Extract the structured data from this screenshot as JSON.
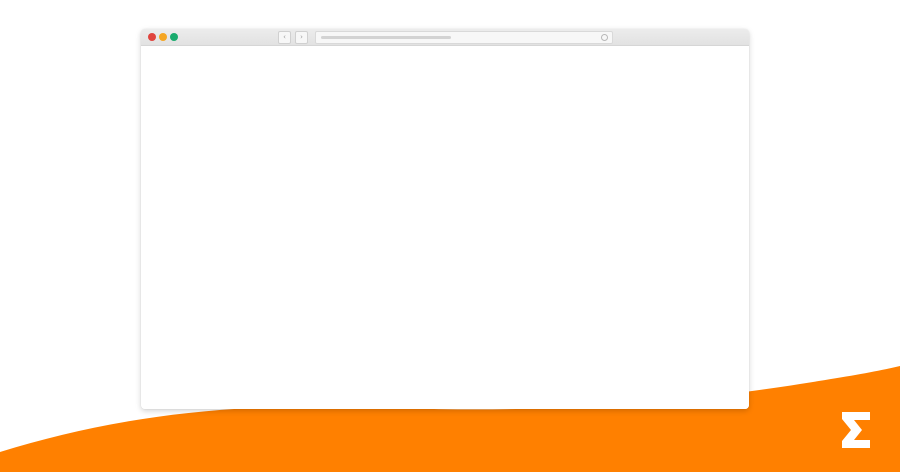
{
  "background": {
    "color": "#ffffff",
    "wave_color": "#ff8000"
  },
  "browser": {
    "traffic_lights": [
      {
        "name": "close",
        "color": "#e0443e"
      },
      {
        "name": "minimize",
        "color": "#f5a623"
      },
      {
        "name": "zoom",
        "color": "#1aab6e"
      }
    ],
    "nav": {
      "back_icon": "chevron-left-icon",
      "forward_icon": "chevron-right-icon",
      "back_glyph": "‹",
      "forward_glyph": "›"
    },
    "address_bar": {
      "url": "",
      "reload_icon": "reload-icon"
    },
    "content": ""
  },
  "brand": {
    "logo_icon": "eventbrite-logo-icon",
    "logo_color": "#ffffff"
  }
}
